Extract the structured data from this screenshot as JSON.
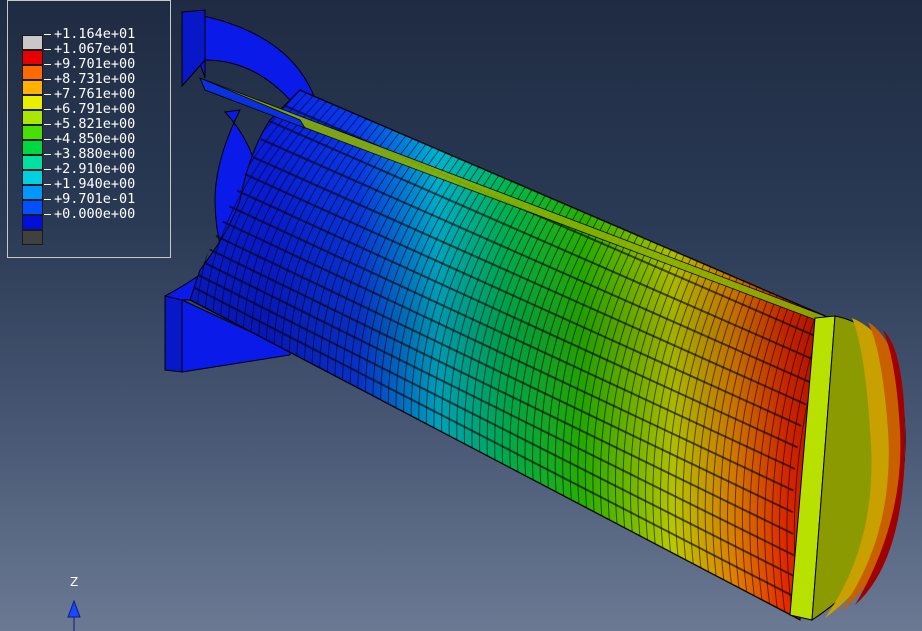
{
  "legend": {
    "entries": [
      {
        "label": "+1.164e+01",
        "color": "#c8c8c8"
      },
      {
        "label": "+1.067e+01",
        "color": "#e80000"
      },
      {
        "label": "+9.701e+00",
        "color": "#ff6a00"
      },
      {
        "label": "+8.731e+00",
        "color": "#ffb000"
      },
      {
        "label": "+7.761e+00",
        "color": "#e8f000"
      },
      {
        "label": "+6.791e+00",
        "color": "#a8e800"
      },
      {
        "label": "+5.821e+00",
        "color": "#48e000"
      },
      {
        "label": "+4.850e+00",
        "color": "#00d840"
      },
      {
        "label": "+3.880e+00",
        "color": "#00e0a0"
      },
      {
        "label": "+2.910e+00",
        "color": "#00d0e0"
      },
      {
        "label": "+1.940e+00",
        "color": "#0098ff"
      },
      {
        "label": "+9.701e-01",
        "color": "#0050ff"
      },
      {
        "label": "+0.000e+00",
        "color": "#0010d8"
      },
      {
        "label": "",
        "color": "#404040"
      }
    ]
  },
  "triad": {
    "axis_label": "Z",
    "color": "#1848ff"
  },
  "model": {
    "flange_color": "#0a1ae8",
    "end_colors": [
      "#8a9a00",
      "#c8a000",
      "#c86000",
      "#c02000",
      "#a00000"
    ]
  }
}
